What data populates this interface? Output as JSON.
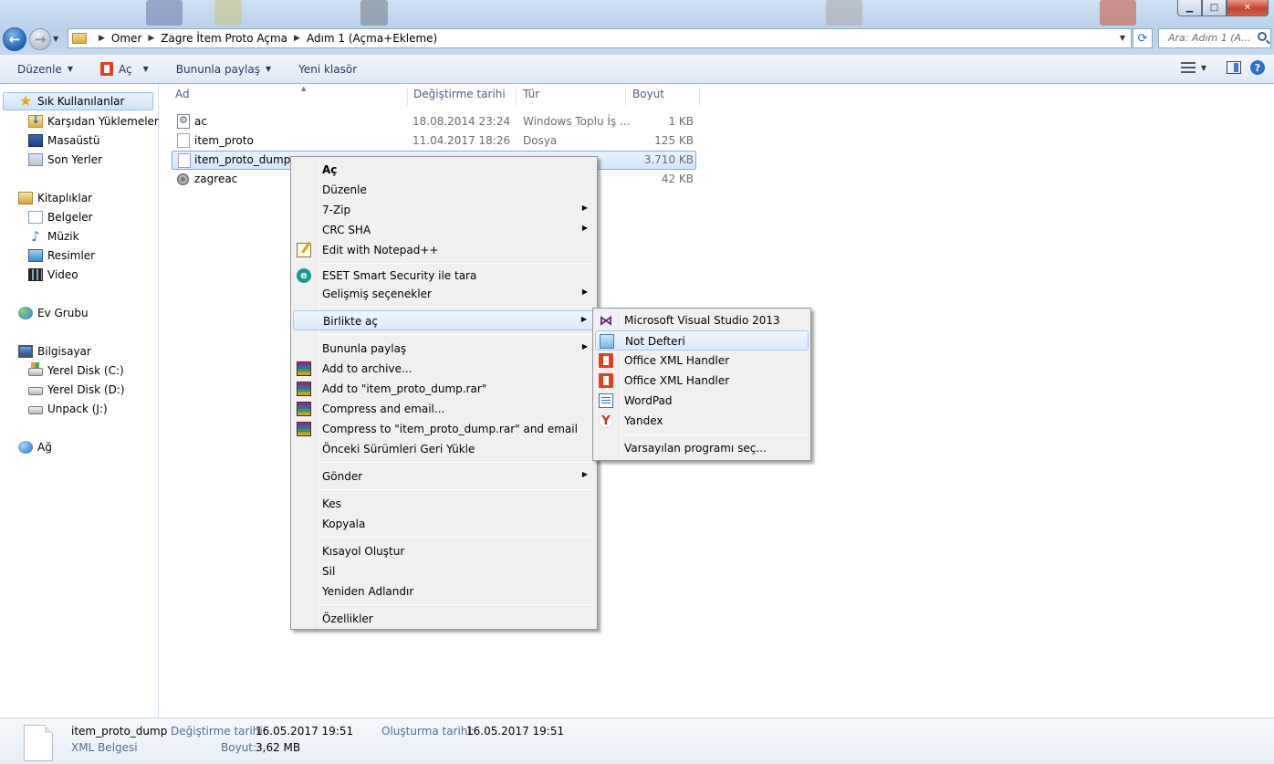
{
  "window": {
    "buttons": {
      "minimize": "▁",
      "maximize": "□",
      "close": "✕"
    }
  },
  "address": {
    "crumbs": [
      "Omer",
      "Zagre İtem Proto Açma",
      "Adım 1 (Açma+Ekleme)"
    ],
    "search_placeholder": "Ara: Adım 1 (A..."
  },
  "toolbar": {
    "organize": "Düzenle",
    "open": "Aç",
    "share": "Bununla paylaş",
    "new_folder": "Yeni klasör"
  },
  "nav": {
    "favorites": "Sık Kullanılanlar",
    "downloads": "Karşıdan Yüklemeler",
    "desktop": "Masaüstü",
    "recent": "Son Yerler",
    "libraries": "Kitaplıklar",
    "documents": "Belgeler",
    "music": "Müzik",
    "pictures": "Resimler",
    "videos": "Video",
    "homegroup": "Ev Grubu",
    "computer": "Bilgisayar",
    "disk_c": "Yerel Disk (C:)",
    "disk_d": "Yerel Disk (D:)",
    "disk_j": "Unpack (J:)",
    "network": "Ağ"
  },
  "columns": {
    "name": "Ad",
    "date": "Değiştirme tarihi",
    "type": "Tür",
    "size": "Boyut"
  },
  "files": [
    {
      "name": "ac",
      "date": "18.08.2014 23:24",
      "type": "Windows Toplu İş ...",
      "size": "1 KB"
    },
    {
      "name": "item_proto",
      "date": "11.04.2017 18:26",
      "type": "Dosya",
      "size": "125 KB"
    },
    {
      "name": "item_proto_dump",
      "date": "",
      "type": "",
      "size": "3.710 KB"
    },
    {
      "name": "zagreac",
      "date": "",
      "type": "",
      "size": "42 KB"
    }
  ],
  "context_menu": {
    "open": "Aç",
    "edit": "Düzenle",
    "zip7": "7-Zip",
    "crc": "CRC SHA",
    "notepadpp": "Edit with Notepad++",
    "eset": "ESET Smart Security ile tara",
    "advanced": "Gelişmiş seçenekler",
    "open_with": "Birlikte aç",
    "share_with": "Bununla paylaş",
    "add_archive": "Add to archive...",
    "add_rar": "Add to \"item_proto_dump.rar\"",
    "compress_email": "Compress and email...",
    "compress_rar_email": "Compress to \"item_proto_dump.rar\" and email",
    "restore": "Önceki Sürümleri Geri Yükle",
    "send_to": "Gönder",
    "cut": "Kes",
    "copy": "Kopyala",
    "shortcut": "Kısayol Oluştur",
    "delete": "Sil",
    "rename": "Yeniden Adlandır",
    "properties": "Özellikler"
  },
  "open_with_menu": {
    "vs": "Microsoft Visual Studio 2013",
    "notepad": "Not Defteri",
    "office1": "Office XML Handler",
    "office2": "Office XML Handler",
    "wordpad": "WordPad",
    "yandex": "Yandex",
    "choose": "Varsayılan programı seç..."
  },
  "details": {
    "name": "item_proto_dump",
    "type": "XML Belgesi",
    "modified_label": "Değiştirme tarihi:",
    "modified": "16.05.2017 19:51",
    "size_label": "Boyut:",
    "size": "3,62 MB",
    "created_label": "Oluşturma tarihi:",
    "created": "16.05.2017 19:51"
  }
}
